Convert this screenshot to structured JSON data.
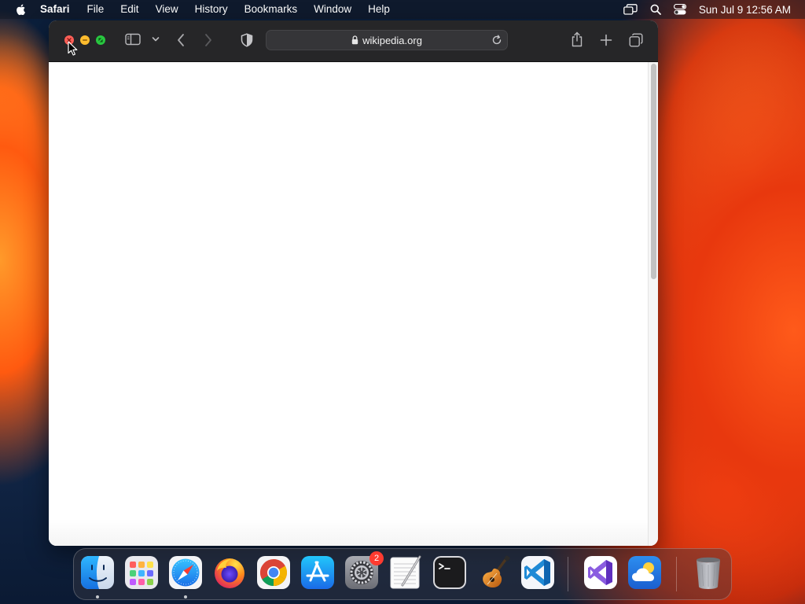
{
  "menubar": {
    "app_name": "Safari",
    "items": [
      "File",
      "Edit",
      "View",
      "History",
      "Bookmarks",
      "Window",
      "Help"
    ],
    "clock": "Sun Jul 9  12:56 AM",
    "status_icons": [
      "screen-mirroring-icon",
      "spotlight-search-icon",
      "control-center-icon"
    ]
  },
  "browser": {
    "url": "wikipedia.org",
    "toolbar_icons": [
      "sidebar-icon",
      "chevron-down-icon",
      "back-icon",
      "forward-icon",
      "privacy-shield-icon",
      "share-icon",
      "new-tab-icon",
      "tab-overview-icon"
    ],
    "page_scroll_fraction": 0.45
  },
  "dock": {
    "apps": [
      {
        "name": "Finder",
        "icon": "finder-icon",
        "running": true
      },
      {
        "name": "Launchpad",
        "icon": "launchpad-icon",
        "running": false
      },
      {
        "name": "Safari",
        "icon": "safari-icon",
        "running": true
      },
      {
        "name": "Firefox",
        "icon": "firefox-icon",
        "running": false
      },
      {
        "name": "Chrome",
        "icon": "chrome-icon",
        "running": false
      },
      {
        "name": "App Store",
        "icon": "app-store-icon",
        "running": false
      },
      {
        "name": "System Settings",
        "icon": "system-settings-icon",
        "running": false,
        "badge": "2"
      },
      {
        "name": "TextEdit",
        "icon": "textedit-icon",
        "running": false
      },
      {
        "name": "Terminal",
        "icon": "terminal-icon",
        "running": false
      },
      {
        "name": "GarageBand",
        "icon": "garageband-icon",
        "running": false
      },
      {
        "name": "Visual Studio Code",
        "icon": "vscode-icon",
        "running": false
      },
      {
        "name": "Visual Studio",
        "icon": "visual-studio-icon",
        "running": false
      },
      {
        "name": "Weather",
        "icon": "weather-icon",
        "running": false
      },
      {
        "name": "Trash",
        "icon": "trash-icon",
        "running": false
      }
    ]
  },
  "colors": {
    "toolbar_bg": "#262628",
    "close": "#fe5f57",
    "minimize": "#febc2e",
    "zoom": "#28c840"
  }
}
